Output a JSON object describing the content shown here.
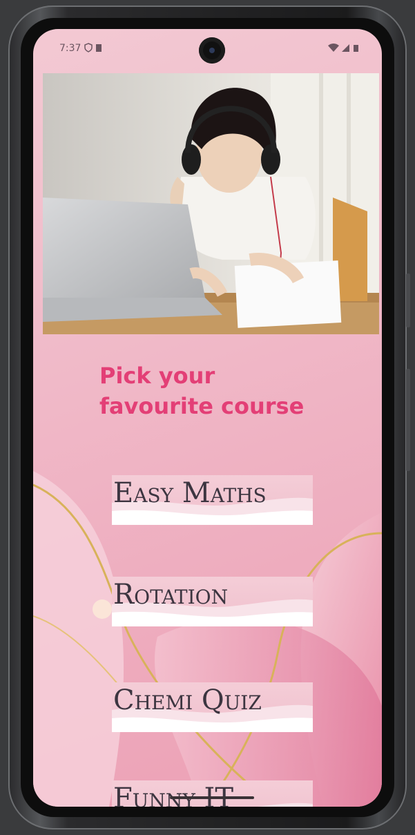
{
  "status_bar": {
    "time": "7:37",
    "left_icons": [
      "shield-icon",
      "sim-card-icon"
    ],
    "right_icons": [
      "wifi-icon",
      "signal-icon",
      "battery-icon"
    ]
  },
  "hero_image": {
    "description_icon": "girl-with-laptop-photo"
  },
  "headline": {
    "line1": "Pick your",
    "line2": "favourite course"
  },
  "courses": [
    {
      "label": "Easy Maths"
    },
    {
      "label": "Rotation"
    },
    {
      "label": "Chemi Quiz"
    },
    {
      "label": "Funny IT"
    }
  ],
  "colors": {
    "accent": "#e33f76",
    "background": "#f0b9c8",
    "button_text": "#3c3540",
    "gold_line": "#d8b25a"
  }
}
